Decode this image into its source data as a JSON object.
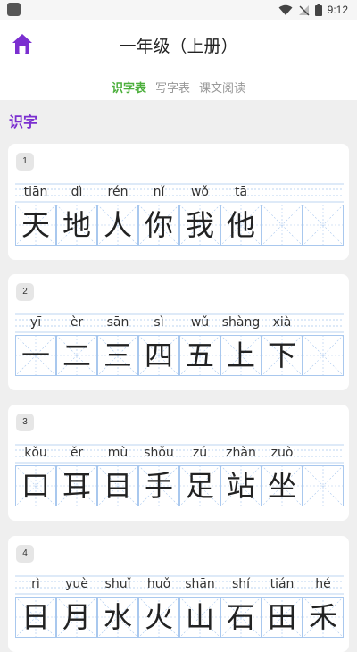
{
  "status": {
    "time": "9:12"
  },
  "header": {
    "title": "一年级（上册）"
  },
  "tabs": [
    {
      "label": "识字表",
      "active": true
    },
    {
      "label": "写字表",
      "active": false
    },
    {
      "label": "课文阅读",
      "active": false
    }
  ],
  "section": {
    "label": "识字"
  },
  "lessons": [
    {
      "num": "1",
      "chars": [
        {
          "py": "tiān",
          "ch": "天"
        },
        {
          "py": "dì",
          "ch": "地"
        },
        {
          "py": "rén",
          "ch": "人"
        },
        {
          "py": "nǐ",
          "ch": "你"
        },
        {
          "py": "wǒ",
          "ch": "我"
        },
        {
          "py": "tā",
          "ch": "他"
        }
      ]
    },
    {
      "num": "2",
      "chars": [
        {
          "py": "yī",
          "ch": "一"
        },
        {
          "py": "èr",
          "ch": "二"
        },
        {
          "py": "sān",
          "ch": "三"
        },
        {
          "py": "sì",
          "ch": "四"
        },
        {
          "py": "wǔ",
          "ch": "五"
        },
        {
          "py": "shàng",
          "ch": "上"
        },
        {
          "py": "xià",
          "ch": "下"
        }
      ]
    },
    {
      "num": "3",
      "chars": [
        {
          "py": "kǒu",
          "ch": "口"
        },
        {
          "py": "ěr",
          "ch": "耳"
        },
        {
          "py": "mù",
          "ch": "目"
        },
        {
          "py": "shǒu",
          "ch": "手"
        },
        {
          "py": "zú",
          "ch": "足"
        },
        {
          "py": "zhàn",
          "ch": "站"
        },
        {
          "py": "zuò",
          "ch": "坐"
        }
      ]
    },
    {
      "num": "4",
      "chars": [
        {
          "py": "rì",
          "ch": "日"
        },
        {
          "py": "yuè",
          "ch": "月"
        },
        {
          "py": "shuǐ",
          "ch": "水"
        },
        {
          "py": "huǒ",
          "ch": "火"
        },
        {
          "py": "shān",
          "ch": "山"
        },
        {
          "py": "shí",
          "ch": "石"
        },
        {
          "py": "tián",
          "ch": "田"
        },
        {
          "py": "hé",
          "ch": "禾"
        }
      ]
    }
  ],
  "colors": {
    "accent": "#4caf3c",
    "section": "#7b2fd0",
    "grid": "#a9c8ee",
    "home": "#7b2fd0"
  }
}
